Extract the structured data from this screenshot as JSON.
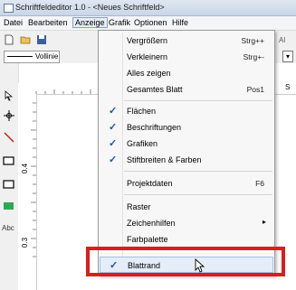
{
  "window": {
    "title": "Schriftfeldeditor 1.0 - <Neues Schriftfeld>"
  },
  "menubar": {
    "items": [
      "Datei",
      "Bearbeiten",
      "Anzeige",
      "Grafik",
      "Optionen",
      "Hilfe"
    ]
  },
  "toolbar": {
    "line_style_label": "Vollinie",
    "right_text": "Al",
    "right_text2": "S"
  },
  "ruler": {
    "v_label_1": "0.4",
    "v_label_2": "0.3"
  },
  "lefttools": {
    "text_tool": "Abc"
  },
  "dropdown": {
    "items": [
      {
        "label": "Vergrößern",
        "shortcut": "Strg++",
        "checked": false
      },
      {
        "label": "Verkleinern",
        "shortcut": "Strg+-",
        "checked": false
      },
      {
        "label": "Alles zeigen",
        "shortcut": "",
        "checked": false
      },
      {
        "label": "Gesamtes Blatt",
        "shortcut": "Pos1",
        "checked": false
      },
      {
        "label": "Flächen",
        "shortcut": "",
        "checked": true
      },
      {
        "label": "Beschriftungen",
        "shortcut": "",
        "checked": true
      },
      {
        "label": "Grafiken",
        "shortcut": "",
        "checked": true
      },
      {
        "label": "Stiftbreiten & Farben",
        "shortcut": "",
        "checked": true
      },
      {
        "label": "Projektdaten",
        "shortcut": "F6",
        "checked": false
      },
      {
        "label": "Raster",
        "shortcut": "",
        "checked": false
      },
      {
        "label": "Zeichenhilfen",
        "shortcut": "",
        "checked": false,
        "submenu": true
      },
      {
        "label": "Farbpalette",
        "shortcut": "",
        "checked": false
      },
      {
        "label": "Blattrand",
        "shortcut": "",
        "checked": true
      }
    ],
    "check_glyph": "✓",
    "submenu_glyph": "▸"
  },
  "colors": {
    "highlight_box": "#e01b1b",
    "check": "#1f4fbf"
  }
}
